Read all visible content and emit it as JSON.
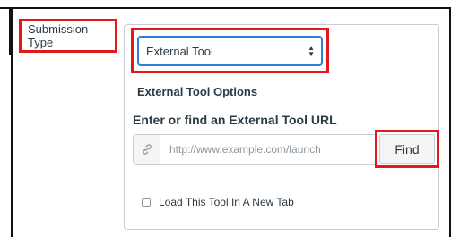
{
  "form": {
    "submission_type_label": "Submission Type",
    "submission_type_value": "External Tool",
    "external_tool_options_heading": "External Tool Options",
    "url_heading": "Enter or find an External Tool URL",
    "url_placeholder": "http://www.example.com/launch",
    "url_value": "",
    "find_button": "Find",
    "new_tab_checkbox_label": "Load This Tool In A New Tab",
    "new_tab_checked": false
  },
  "icons": {
    "link": "link-icon",
    "select_arrows": "up-down-arrows-icon"
  },
  "colors": {
    "highlight": "#e3181d",
    "focus_border": "#2a81d4",
    "text": "#2d3b45"
  }
}
